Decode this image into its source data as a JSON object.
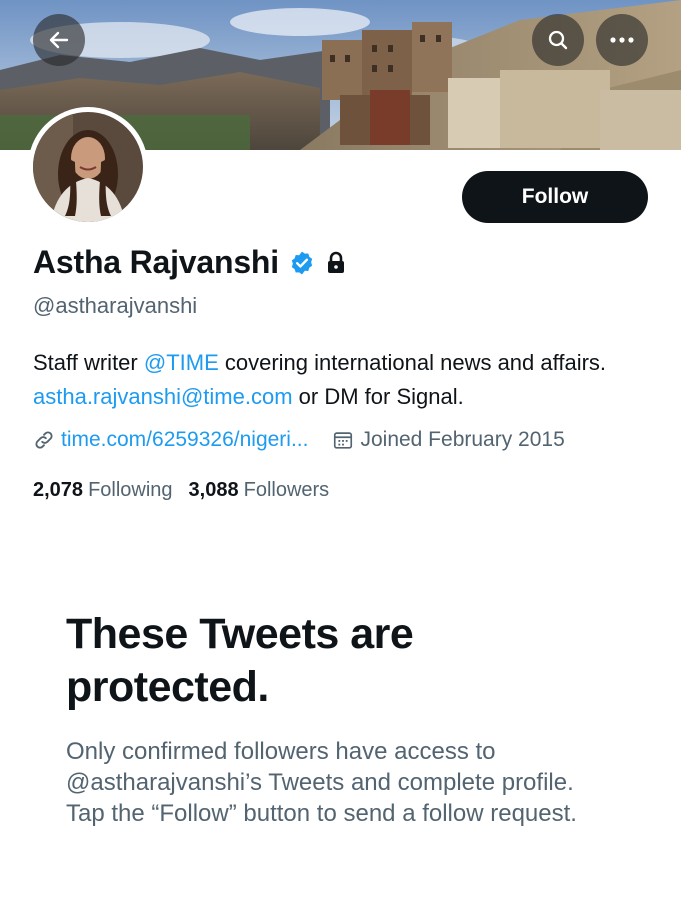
{
  "header": {
    "back_icon": "arrow-left-icon",
    "search_icon": "search-icon",
    "more_icon": "more-horizontal-icon"
  },
  "profile": {
    "display_name": "Astha Rajvanshi",
    "handle": "@astharajvanshi",
    "verified": true,
    "protected": true,
    "follow_label": "Follow",
    "bio": {
      "part1": "Staff writer ",
      "mention": "@TIME",
      "part2": " covering international news and affairs. ",
      "email": "astha.rajvanshi@time.com",
      "part3": " or DM for Signal."
    },
    "website": "time.com/6259326/nigeri...",
    "joined": "Joined February 2015",
    "following_count": "2,078",
    "following_label": "Following",
    "followers_count": "3,088",
    "followers_label": "Followers"
  },
  "protected_notice": {
    "title": "These Tweets are protected.",
    "body": "Only confirmed followers have access to @astharajvanshi’s Tweets and complete profile. Tap the “Follow” button to send a follow request."
  },
  "colors": {
    "accent": "#1d9bf0",
    "text_primary": "#0f1419",
    "text_secondary": "#536471",
    "button_dark": "#0f1419"
  }
}
